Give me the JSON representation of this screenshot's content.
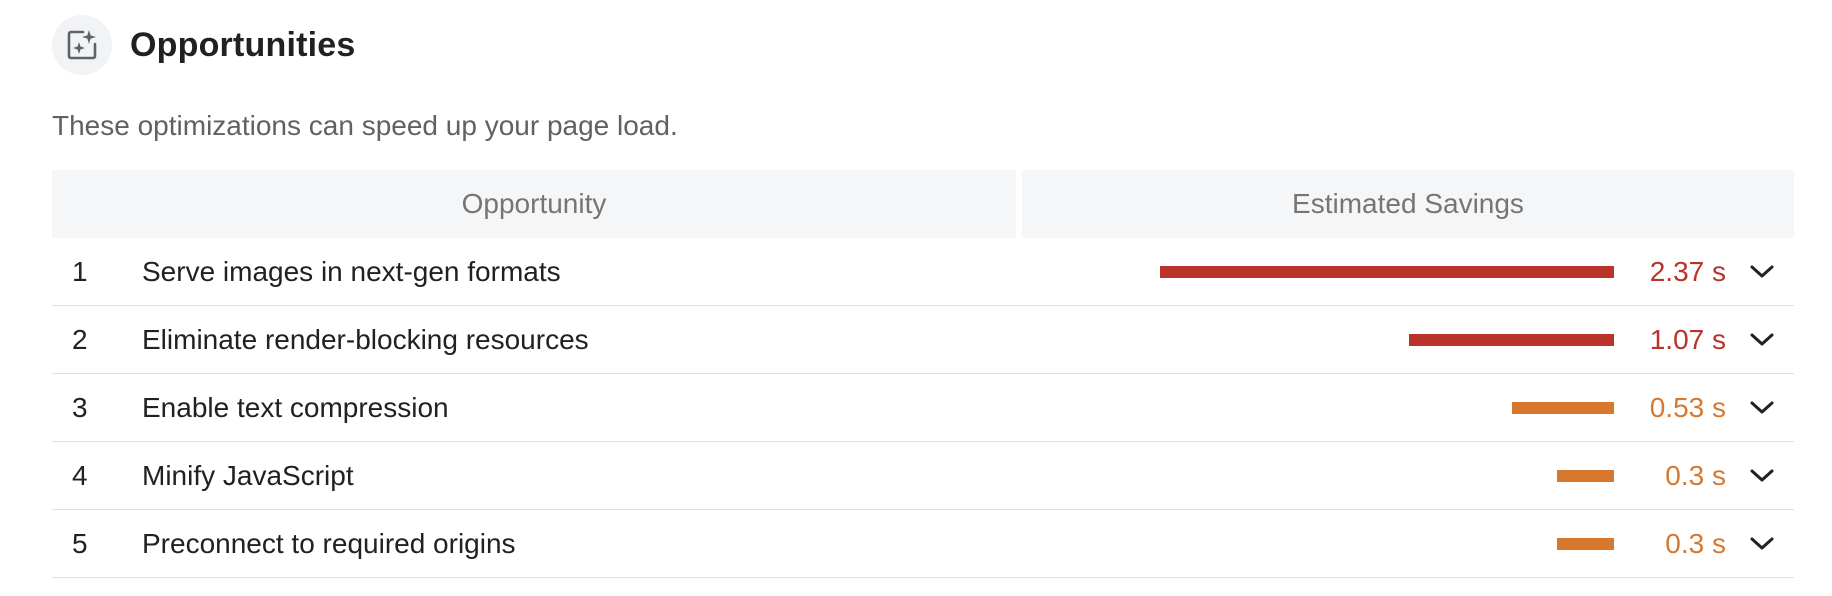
{
  "section": {
    "icon": "opportunity-icon",
    "title": "Opportunities",
    "description": "These optimizations can speed up your page load."
  },
  "table": {
    "columns": [
      "Opportunity",
      "Estimated Savings"
    ],
    "max_savings_s": 2.37,
    "rows": [
      {
        "index": "1",
        "title": "Serve images in next-gen formats",
        "savings_s": 2.37,
        "savings_label": "2.37 s",
        "severity": "fail"
      },
      {
        "index": "2",
        "title": "Eliminate render-blocking resources",
        "savings_s": 1.07,
        "savings_label": "1.07 s",
        "severity": "fail"
      },
      {
        "index": "3",
        "title": "Enable text compression",
        "savings_s": 0.53,
        "savings_label": "0.53 s",
        "severity": "average"
      },
      {
        "index": "4",
        "title": "Minify JavaScript",
        "savings_s": 0.3,
        "savings_label": "0.3 s",
        "severity": "average"
      },
      {
        "index": "5",
        "title": "Preconnect to required origins",
        "savings_s": 0.3,
        "savings_label": "0.3 s",
        "severity": "average"
      }
    ]
  },
  "colors": {
    "fail": "#b9332b",
    "average": "#d8782f",
    "header_bg": "#f5f6f8",
    "icon_bg": "#f1f3f4"
  },
  "icons": {
    "expand": "chevron-down-icon"
  }
}
